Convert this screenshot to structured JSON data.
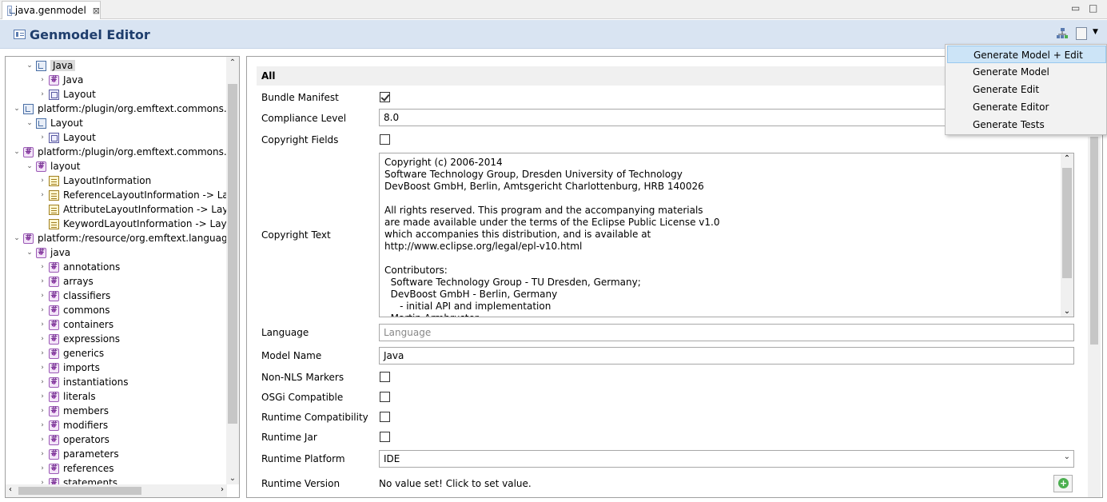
{
  "tab": {
    "title": "java.genmodel",
    "close": "⊠"
  },
  "window_buttons": {
    "minimize": "▭",
    "maximize": "□"
  },
  "header": {
    "title": "Genmodel Editor"
  },
  "tree": {
    "rows": [
      {
        "label": "Java",
        "indent": 1,
        "twisty": "⌄",
        "icon": "genmodel-icon",
        "selected": true
      },
      {
        "label": "Java",
        "indent": 2,
        "twisty": "›",
        "icon": "package-icon"
      },
      {
        "label": "Layout",
        "indent": 2,
        "twisty": "›",
        "icon": "layout-icon"
      },
      {
        "label": "platform:/plugin/org.emftext.commons.layout",
        "indent": 0,
        "twisty": "⌄",
        "icon": "genmodel-icon"
      },
      {
        "label": "Layout",
        "indent": 1,
        "twisty": "⌄",
        "icon": "genmodel-icon"
      },
      {
        "label": "Layout",
        "indent": 2,
        "twisty": "›",
        "icon": "layout-icon"
      },
      {
        "label": "platform:/plugin/org.emftext.commons.layout",
        "indent": 0,
        "twisty": "⌄",
        "icon": "package-icon"
      },
      {
        "label": "layout",
        "indent": 1,
        "twisty": "⌄",
        "icon": "package-icon"
      },
      {
        "label": "LayoutInformation",
        "indent": 2,
        "twisty": "›",
        "icon": "class-icon"
      },
      {
        "label": "ReferenceLayoutInformation -> LayoutInformation",
        "indent": 2,
        "twisty": "›",
        "icon": "class-icon"
      },
      {
        "label": "AttributeLayoutInformation -> LayoutInformation",
        "indent": 2,
        "twisty": "",
        "icon": "class-icon"
      },
      {
        "label": "KeywordLayoutInformation -> LayoutInformation",
        "indent": 2,
        "twisty": "",
        "icon": "class-icon"
      },
      {
        "label": "platform:/resource/org.emftext.language.java",
        "indent": 0,
        "twisty": "⌄",
        "icon": "package-icon"
      },
      {
        "label": "java",
        "indent": 1,
        "twisty": "⌄",
        "icon": "package-icon"
      },
      {
        "label": "annotations",
        "indent": 2,
        "twisty": "›",
        "icon": "package-icon"
      },
      {
        "label": "arrays",
        "indent": 2,
        "twisty": "›",
        "icon": "package-icon"
      },
      {
        "label": "classifiers",
        "indent": 2,
        "twisty": "›",
        "icon": "package-icon"
      },
      {
        "label": "commons",
        "indent": 2,
        "twisty": "›",
        "icon": "package-icon"
      },
      {
        "label": "containers",
        "indent": 2,
        "twisty": "›",
        "icon": "package-icon"
      },
      {
        "label": "expressions",
        "indent": 2,
        "twisty": "›",
        "icon": "package-icon"
      },
      {
        "label": "generics",
        "indent": 2,
        "twisty": "›",
        "icon": "package-icon"
      },
      {
        "label": "imports",
        "indent": 2,
        "twisty": "›",
        "icon": "package-icon"
      },
      {
        "label": "instantiations",
        "indent": 2,
        "twisty": "›",
        "icon": "package-icon"
      },
      {
        "label": "literals",
        "indent": 2,
        "twisty": "›",
        "icon": "package-icon"
      },
      {
        "label": "members",
        "indent": 2,
        "twisty": "›",
        "icon": "package-icon"
      },
      {
        "label": "modifiers",
        "indent": 2,
        "twisty": "›",
        "icon": "package-icon"
      },
      {
        "label": "operators",
        "indent": 2,
        "twisty": "›",
        "icon": "package-icon"
      },
      {
        "label": "parameters",
        "indent": 2,
        "twisty": "›",
        "icon": "package-icon"
      },
      {
        "label": "references",
        "indent": 2,
        "twisty": "›",
        "icon": "package-icon"
      },
      {
        "label": "statements",
        "indent": 2,
        "twisty": "›",
        "icon": "package-icon"
      }
    ]
  },
  "form": {
    "section_title": "All",
    "bundle_manifest": {
      "label": "Bundle Manifest",
      "checked": true
    },
    "compliance_level": {
      "label": "Compliance Level",
      "value": "8.0"
    },
    "copyright_fields": {
      "label": "Copyright Fields",
      "checked": false
    },
    "copyright_text": {
      "label": "Copyright Text",
      "value": "Copyright (c) 2006-2014\nSoftware Technology Group, Dresden University of Technology\nDevBoost GmbH, Berlin, Amtsgericht Charlottenburg, HRB 140026\n\nAll rights reserved. This program and the accompanying materials\nare made available under the terms of the Eclipse Public License v1.0\nwhich accompanies this distribution, and is available at\nhttp://www.eclipse.org/legal/epl-v10.html\n\nContributors:\n  Software Technology Group - TU Dresden, Germany;\n  DevBoost GmbH - Berlin, Germany\n     - initial API and implementation\n  Martin Armbruster"
    },
    "language": {
      "label": "Language",
      "placeholder": "Language"
    },
    "model_name": {
      "label": "Model Name",
      "value": "Java"
    },
    "non_nls_markers": {
      "label": "Non-NLS Markers",
      "checked": false
    },
    "osgi_compatible": {
      "label": "OSGi Compatible",
      "checked": false
    },
    "runtime_compatibility": {
      "label": "Runtime Compatibility",
      "checked": false
    },
    "runtime_jar": {
      "label": "Runtime Jar",
      "checked": false
    },
    "runtime_platform": {
      "label": "Runtime Platform",
      "value": "IDE"
    },
    "runtime_version": {
      "label": "Runtime Version",
      "value": "No value set! Click to set value."
    }
  },
  "menu": {
    "items": [
      {
        "label": "Generate Model + Edit",
        "highlighted": true
      },
      {
        "label": "Generate Model"
      },
      {
        "label": "Generate Edit"
      },
      {
        "label": "Generate Editor"
      },
      {
        "label": "Generate Tests"
      }
    ]
  },
  "colors": {
    "header_bg": "#d9e4f2",
    "header_title": "#1f3e6d",
    "menu_highlight": "#cce4f7"
  }
}
